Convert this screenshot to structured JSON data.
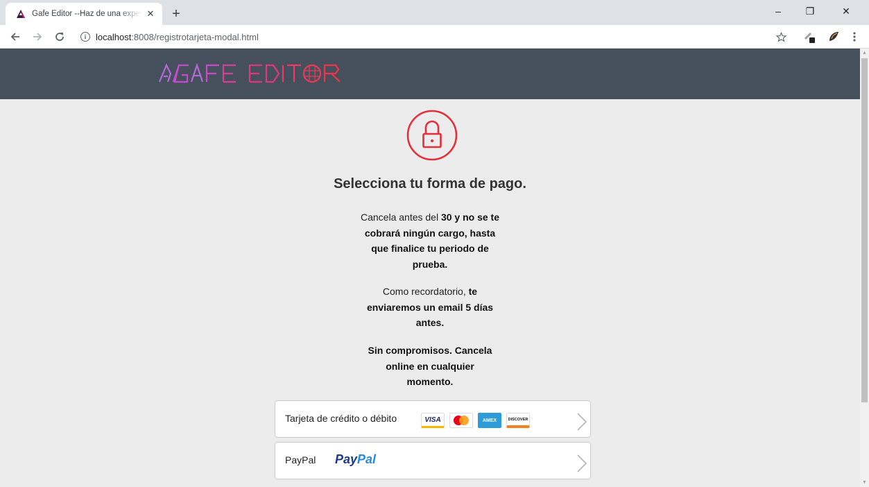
{
  "browser": {
    "tab_title": "Gafe Editor --Haz de una experiencia",
    "tab_close": "✕",
    "new_tab": "+",
    "url_host": "localhost",
    "url_path": ":8008/registrotarjeta-modal.html",
    "window_controls": {
      "minimize": "–",
      "restore": "❐",
      "close": "✕"
    }
  },
  "site": {
    "logo_text": "GAFE EDITOR",
    "brand_color": "#46505d",
    "accent_color": "#e52e3a"
  },
  "main": {
    "title": "Selecciona tu forma de pago.",
    "para1": {
      "pre": "Cancela antes del ",
      "bold": "30 y no se te cobrará ningún cargo, hasta que finalice tu periodo de prueba."
    },
    "para2": {
      "pre": "Como recordatorio, ",
      "bold": "te enviaremos un email 5 días antes."
    },
    "para3": {
      "bold": "Sin compromisos. Cancela online en cualquier momento."
    },
    "payment_options": [
      {
        "label": "Tarjeta de crédito o débito",
        "cards": [
          "VISA",
          "MasterCard",
          "AMEX",
          "DISCOVER"
        ]
      },
      {
        "label": "PayPal",
        "logo_pay": "Pay",
        "logo_pal": "Pal"
      }
    ]
  }
}
